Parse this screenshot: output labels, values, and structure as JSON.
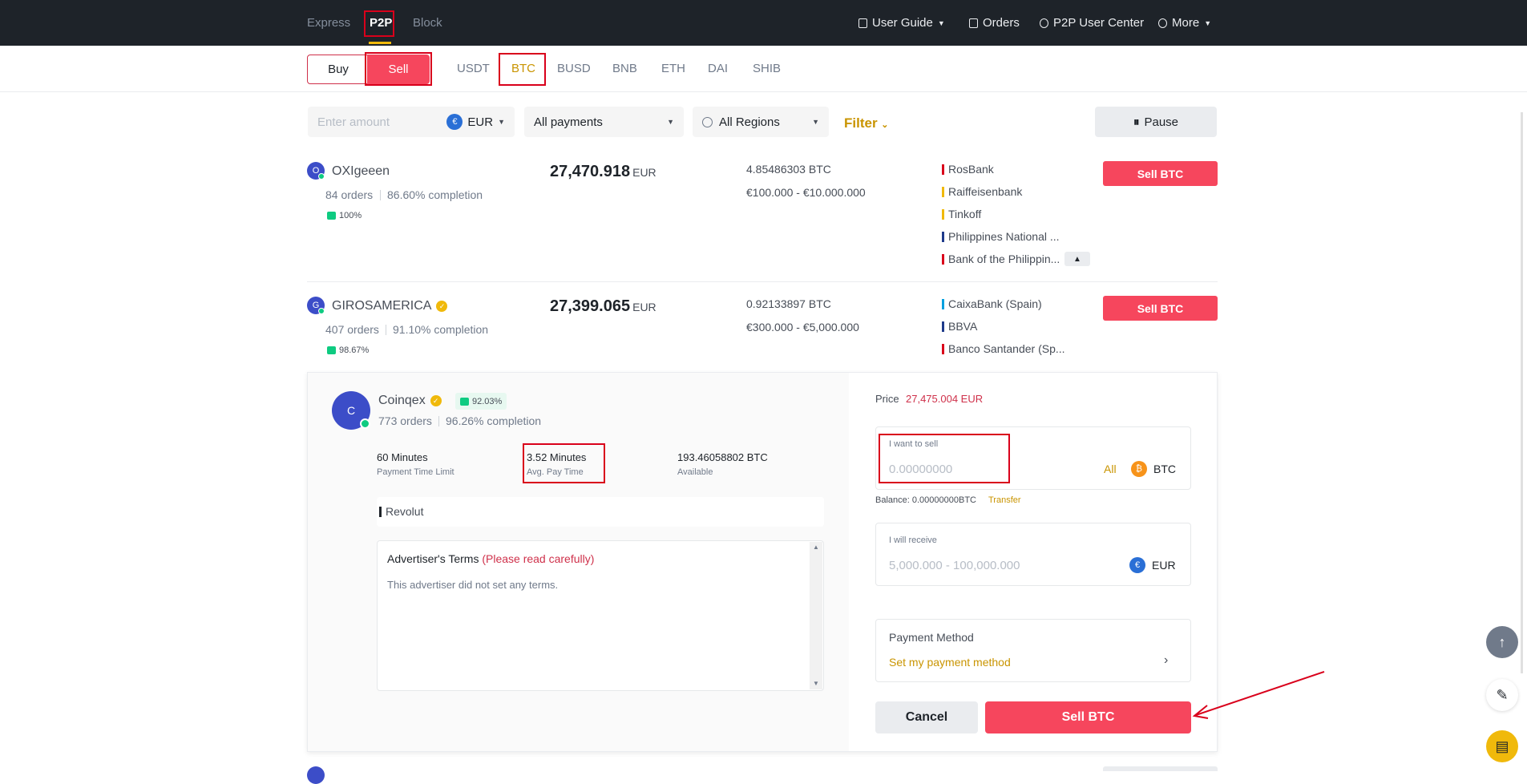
{
  "topnav": {
    "tabs": [
      "Express",
      "P2P",
      "Block"
    ],
    "user_guide": "User Guide",
    "orders": "Orders",
    "user_center": "P2P User Center",
    "more": "More"
  },
  "subnav": {
    "buy": "Buy",
    "sell": "Sell",
    "assets": [
      "USDT",
      "BTC",
      "BUSD",
      "BNB",
      "ETH",
      "DAI",
      "SHIB"
    ]
  },
  "filters": {
    "amount_placeholder": "Enter amount",
    "fiat": "EUR",
    "payments": "All payments",
    "regions": "All Regions",
    "filter": "Filter",
    "pause": "Pause"
  },
  "ads": [
    {
      "initial": "O",
      "name": "OXIgeeen",
      "orders": "84 orders",
      "completion": "86.60% completion",
      "rating": "100%",
      "price": "27,470.918",
      "currency": "EUR",
      "available": "4.85486303 BTC",
      "limit": "€100.000 - €10.000.000",
      "payments": [
        "RosBank",
        "Raiffeisenbank",
        "Tinkoff",
        "Philippines National ...",
        "Bank of the Philippin..."
      ],
      "action": "Sell BTC"
    },
    {
      "initial": "G",
      "name": "GIROSAMERICA",
      "orders": "407 orders",
      "completion": "91.10% completion",
      "rating": "98.67%",
      "price": "27,399.065",
      "currency": "EUR",
      "available": "0.92133897 BTC",
      "limit": "€300.000 - €5,000.000",
      "payments": [
        "CaixaBank (Spain)",
        "BBVA",
        "Banco Santander (Sp..."
      ],
      "action": "Sell BTC"
    }
  ],
  "panel": {
    "initial": "C",
    "name": "Coinqex",
    "rating": "92.03%",
    "orders": "773 orders",
    "completion": "96.26% completion",
    "time_limit_value": "60 Minutes",
    "time_limit_label": "Payment Time Limit",
    "avg_pay_value": "3.52 Minutes",
    "avg_pay_label": "Avg. Pay Time",
    "available_value": "193.46058802 BTC",
    "available_label": "Available",
    "payment": "Revolut",
    "terms_title": "Advertiser's Terms",
    "terms_note": "(Please read carefully)",
    "terms_text": "This advertiser did not set any terms.",
    "price_label": "Price",
    "price_value": "27,475.004 EUR",
    "sell_label": "I want to sell",
    "sell_placeholder": "0.00000000",
    "all": "All",
    "sell_coin": "BTC",
    "balance": "Balance: 0.00000000BTC",
    "transfer": "Transfer",
    "receive_label": "I will receive",
    "receive_placeholder": "5,000.000 - 100,000.000",
    "receive_coin": "EUR",
    "pm_label": "Payment Method",
    "pm_link": "Set my payment method",
    "cancel": "Cancel",
    "sell_btn": "Sell BTC"
  },
  "colors": {
    "sell_red": "#f6465d",
    "gold": "#c99400",
    "annotation_red": "#d9001b"
  }
}
